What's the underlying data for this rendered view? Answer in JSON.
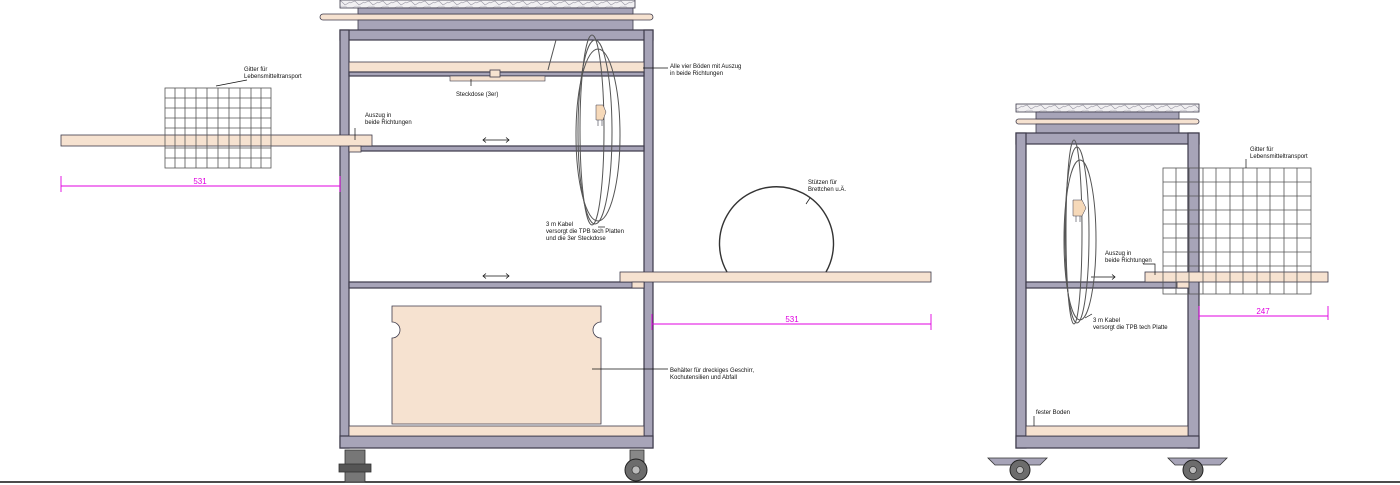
{
  "labels": {
    "grid_left": [
      "Gitter für",
      "Lebensmitteltransport"
    ],
    "outlet": "Steckdose (3er)",
    "all_shelves": [
      "Alle vier Böden mit Auszug",
      "in beide Richtungen"
    ],
    "pullout_left": [
      "Auszug in",
      "beide Richtungen"
    ],
    "cable_left": [
      "3 m Kabel",
      "versorgt die TPB tech Platten",
      "und die 3er Steckdose"
    ],
    "supports": [
      "Stützen für",
      "Brettchen u.Ä."
    ],
    "container": [
      "Behälter für dreckiges Geschirr,",
      "Kochutensilien und Abfall"
    ],
    "grid_right": [
      "Gitter für",
      "Lebensmitteltransport"
    ],
    "pullout_right": [
      "Auszug in",
      "beide Richtungen"
    ],
    "cable_right": [
      "3 m Kabel",
      "versorgt die TPB tech Platte"
    ],
    "fixed_floor": "fester Boden"
  },
  "dimensions": {
    "left_extension": "531",
    "right_extension": "531",
    "side_extension": "247"
  },
  "colors": {
    "frame": "#a7a4b8",
    "board": "#f6e2d0",
    "dimension": "#e000e0",
    "outline": "#3d3a4a"
  }
}
